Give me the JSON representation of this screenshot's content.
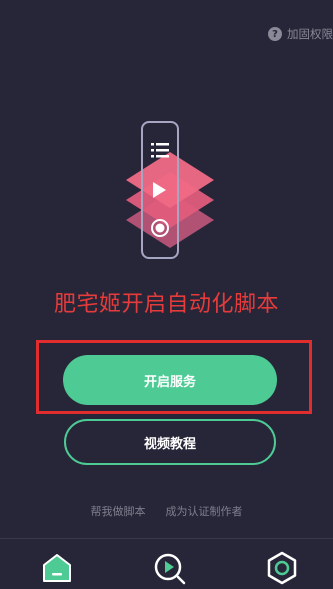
{
  "header": {
    "permission_link": "加固权限",
    "help_icon": "question-circle-icon"
  },
  "hero": {
    "icons": [
      "list-icon",
      "play-icon",
      "record-icon"
    ],
    "colors": {
      "pink": "#f06a85",
      "rose": "#e05c7c",
      "mauve": "#b85478",
      "frame": "#a6a6c2"
    }
  },
  "main": {
    "headline": "肥宅姬开启自动化脚本",
    "start_button": "开启服务",
    "video_button": "视频教程"
  },
  "footer": {
    "help_script": "帮我做脚本",
    "become_author": "成为认证制作者"
  },
  "nav": {
    "items": [
      "home-icon",
      "script-search-icon",
      "settings-icon"
    ]
  },
  "colors": {
    "background": "#272638",
    "accent": "#4ecb94",
    "highlight": "#e12d2d",
    "headline": "#e63b3b"
  }
}
